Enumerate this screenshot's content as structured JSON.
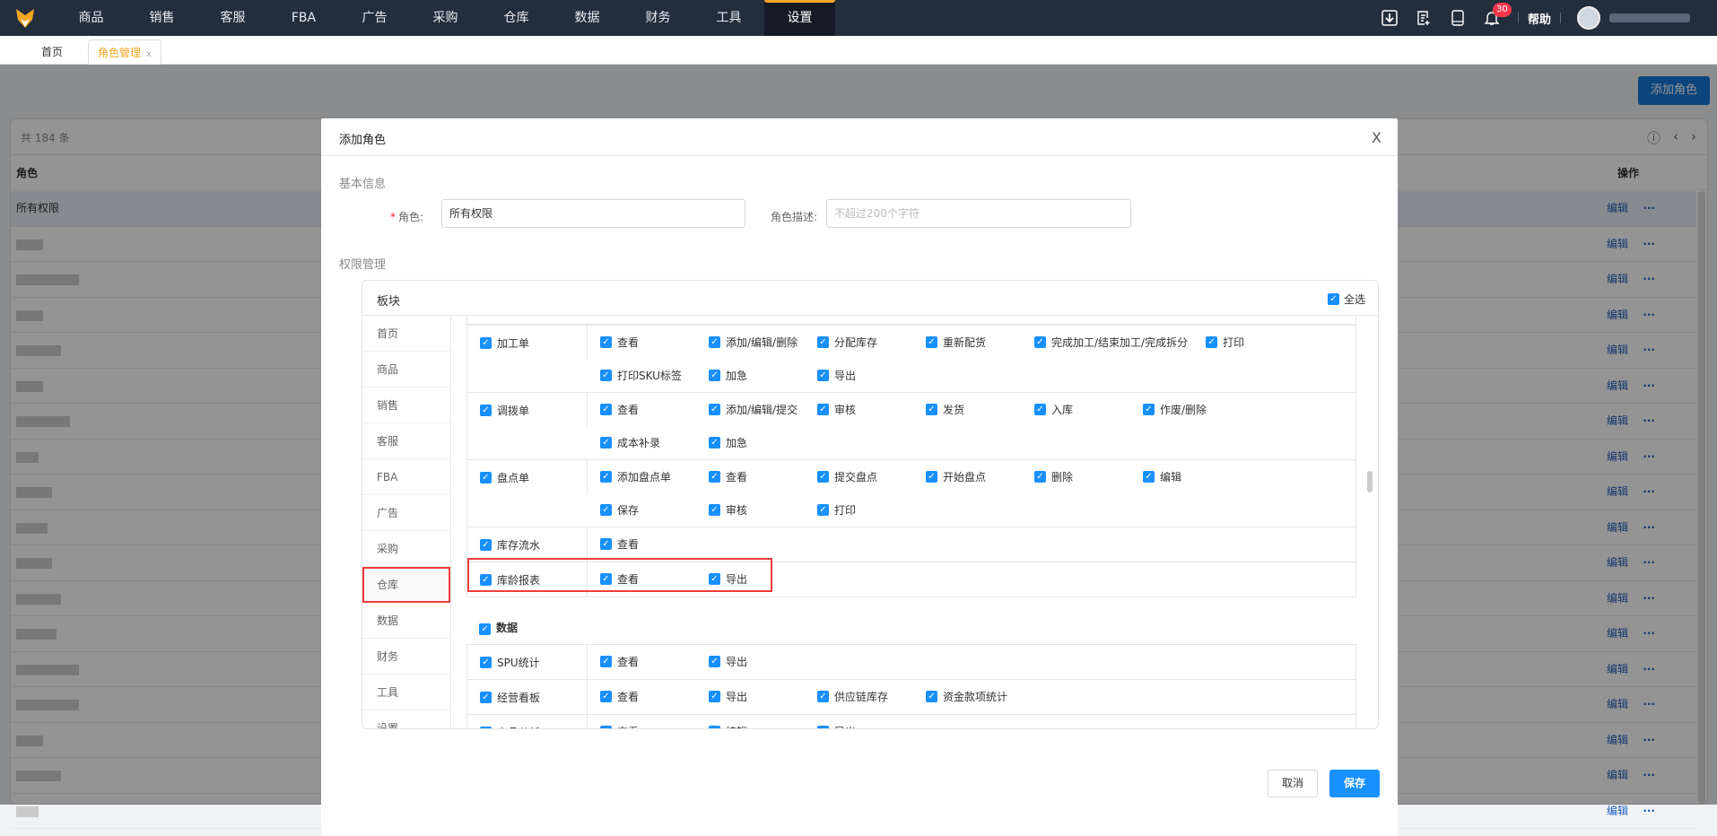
{
  "nav": {
    "items": [
      "商品",
      "销售",
      "客服",
      "FBA",
      "广告",
      "采购",
      "仓库",
      "数据",
      "财务",
      "工具",
      "设置"
    ],
    "active": "设置",
    "notifications": "30",
    "help": "帮助"
  },
  "tabs": {
    "home": "首页",
    "current": "角色管理",
    "close": "x"
  },
  "page": {
    "add_role": "添加角色",
    "total": "共 184 条",
    "col_role": "角色",
    "col_action": "操作",
    "first_row": "所有权限",
    "edit": "编辑",
    "more": "···"
  },
  "modal": {
    "title": "添加角色",
    "close": "X",
    "basic_info": "基本信息",
    "role_label": "角色:",
    "role_value": "所有权限",
    "desc_label": "角色描述:",
    "desc_placeholder": "不超过200个字符",
    "perm_title": "权限管理",
    "block": "板块",
    "select_all": "全选",
    "menu": [
      "首页",
      "商品",
      "销售",
      "客服",
      "FBA",
      "广告",
      "采购",
      "仓库",
      "数据",
      "财务",
      "工具",
      "设置"
    ],
    "selected_menu": "仓库",
    "warehouse_rows": [
      {
        "name": "加工单",
        "perms": [
          "查看",
          "添加/编辑/删除",
          "分配库存",
          "重新配货",
          "完成加工/结束加工/完成拆分",
          "打印",
          "打印SKU标签",
          "加急",
          "导出"
        ]
      },
      {
        "name": "调拨单",
        "perms": [
          "查看",
          "添加/编辑/提交",
          "审核",
          "发货",
          "入库",
          "作废/删除",
          "成本补录",
          "加急"
        ]
      },
      {
        "name": "盘点单",
        "perms": [
          "添加盘点单",
          "查看",
          "提交盘点",
          "开始盘点",
          "删除",
          "编辑",
          "保存",
          "审核",
          "打印"
        ]
      },
      {
        "name": "库存流水",
        "perms": [
          "查看"
        ]
      },
      {
        "name": "库龄报表",
        "perms": [
          "查看",
          "导出"
        ]
      }
    ],
    "data_section": "数据",
    "data_rows": [
      {
        "name": "SPU统计",
        "perms": [
          "查看",
          "导出"
        ]
      },
      {
        "name": "经营看板",
        "perms": [
          "查看",
          "导出",
          "供应链库存",
          "资金款项统计"
        ]
      },
      {
        "name": "产品分析",
        "perms": [
          "查看",
          "编辑",
          "导出"
        ]
      }
    ],
    "cancel": "取消",
    "save": "保存"
  },
  "colors": {
    "accent": "#1890ff",
    "highlight": "#f03c3c",
    "brand": "#f5a623"
  }
}
